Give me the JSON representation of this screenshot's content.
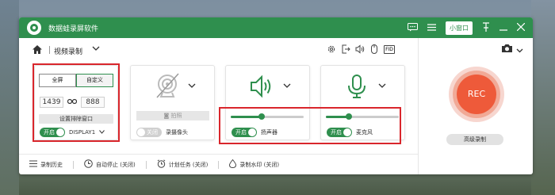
{
  "app": {
    "title": "数据蛙录屏软件"
  },
  "titlebar": {
    "mini_window_label": "小窗口",
    "icons": [
      "chat-icon",
      "menu-icon",
      "pin-icon",
      "minimize-icon",
      "close-icon"
    ]
  },
  "toolbar": {
    "mode_label": "视频录制",
    "tool_icons": [
      "gear-icon",
      "export-icon",
      "speaker-icon",
      "mouse-icon"
    ],
    "fid_label": "FID"
  },
  "screen_panel": {
    "tab_fullscreen": "全屏",
    "tab_custom": "自定义",
    "width": "1439",
    "height": "888",
    "exclude_window_label": "设置排除窗口",
    "toggle_label": "开启",
    "display_label": "DISPLAY1"
  },
  "camera_panel": {
    "photo_label": "拍照",
    "toggle_label": "关闭",
    "device_label": "录摄像头"
  },
  "speaker_panel": {
    "volume": 0.42,
    "toggle_label": "开启",
    "device_label": "扬声器"
  },
  "mic_panel": {
    "volume": 0.32,
    "toggle_label": "开启",
    "device_label": "麦克风"
  },
  "rec": {
    "label": "REC",
    "advanced_label": "高级录制"
  },
  "bottom_bar": {
    "history": "录制历史",
    "auto_stop": "自动停止 (关闭)",
    "schedule": "计划任务 (关闭)",
    "watermark": "录制水印 (关闭)"
  },
  "colors": {
    "brand_green": "#2f8f4e",
    "rec_orange": "#ee5a3a",
    "highlight_red": "#d9262c"
  }
}
